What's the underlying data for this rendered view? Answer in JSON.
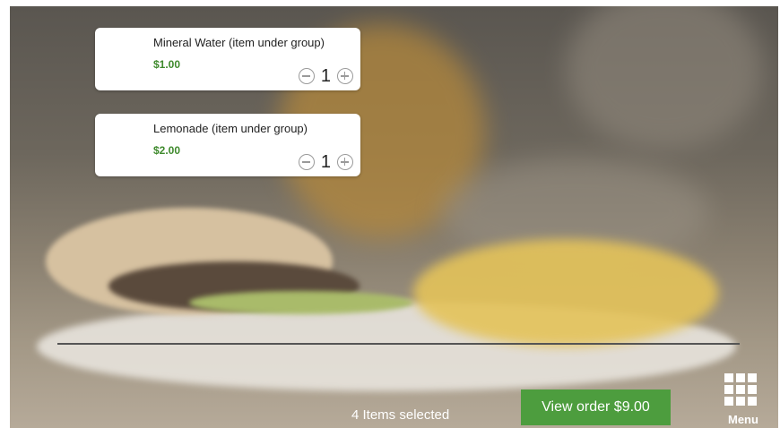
{
  "cart": {
    "items": [
      {
        "name": "Mineral Water (item under group)",
        "price": "$1.00",
        "quantity": "1"
      },
      {
        "name": "Lemonade (item under group)",
        "price": "$2.00",
        "quantity": "1"
      }
    ]
  },
  "footer": {
    "selected_text": "4 Items selected",
    "view_order_label": "View order $9.00",
    "menu_label": "Menu",
    "menu_icon": "grid-icon"
  },
  "colors": {
    "price": "#3f8a2d",
    "view_order_button": "#4d9d3e"
  }
}
